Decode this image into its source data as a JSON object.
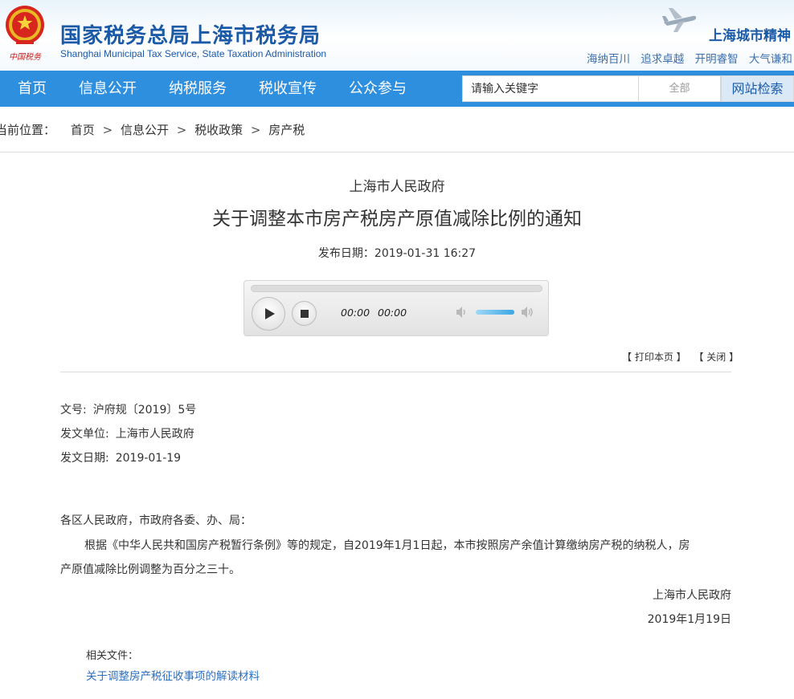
{
  "header": {
    "logo_cn": "国家税务总局上海市税务局",
    "logo_en": "Shanghai Municipal Tax Service, State Taxation Administration",
    "emblem_caption": "中国税务",
    "spirit_title": "上海城市精神",
    "spirit_words": [
      "海纳百川",
      "追求卓越",
      "开明睿智",
      "大气谦和"
    ]
  },
  "nav": {
    "items": [
      "首页",
      "信息公开",
      "纳税服务",
      "税收宣传",
      "公众参与"
    ],
    "search_placeholder": "请输入关键字",
    "scope": "全部",
    "search_button": "网站检索"
  },
  "breadcrumb": {
    "label": "当前位置：",
    "items": [
      "首页",
      "信息公开",
      "税收政策",
      "房产税"
    ],
    "separator": ">"
  },
  "article": {
    "issuer": "上海市人民政府",
    "title": "关于调整本市房产税房产原值减除比例的通知",
    "pub_label": "发布日期：",
    "pub_date": "2019-01-31 16:27"
  },
  "audio": {
    "current_time": "00:00",
    "duration": "00:00",
    "progress": 0,
    "volume": 1.0
  },
  "tools": {
    "print": "【 打印本页 】",
    "close": "【 关闭 】"
  },
  "meta": {
    "doc_no_label": "文号:",
    "doc_no": "沪府规〔2019〕5号",
    "unit_label": "发文单位:",
    "unit": "上海市人民政府",
    "date_label": "发文日期:",
    "date": "2019-01-19"
  },
  "body": {
    "salutation": "各区人民政府，市政府各委、办、局：",
    "para_line1": "根据《中华人民共和国房产税暂行条例》等的规定，自2019年1月1日起，本市按照房产余值计算缴纳房产税的纳税人，房",
    "para_line2": "产原值减除比例调整为百分之三十。",
    "signature": "上海市人民政府",
    "sign_date": "2019年1月19日"
  },
  "related": {
    "label": "相关文件：",
    "link": "关于调整房产税征收事项的解读材料"
  },
  "colors": {
    "brand_blue": "#1b5aa7",
    "nav_blue": "#2f8fdf",
    "link_blue": "#2a6fc0"
  }
}
